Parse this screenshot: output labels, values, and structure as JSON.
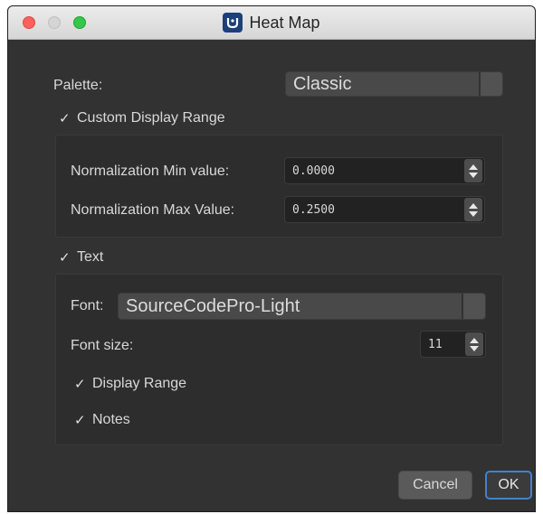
{
  "window": {
    "title": "Heat Map"
  },
  "palette": {
    "label": "Palette:",
    "value": "Classic"
  },
  "custom_range": {
    "checkbox_label": "Custom Display Range",
    "checked": true,
    "min_label": "Normalization Min value:",
    "min_value": "0.0000",
    "max_label": "Normalization Max Value:",
    "max_value": "0.2500"
  },
  "text_section": {
    "checkbox_label": "Text",
    "checked": true,
    "font_label": "Font:",
    "font_value": "SourceCodePro-Light",
    "font_size_label": "Font size:",
    "font_size_value": "11",
    "display_range_label": "Display Range",
    "display_range_checked": true,
    "notes_label": "Notes",
    "notes_checked": true
  },
  "buttons": {
    "cancel": "Cancel",
    "ok": "OK"
  },
  "colors": {
    "accent": "#3f83d0",
    "background": "#323232"
  }
}
